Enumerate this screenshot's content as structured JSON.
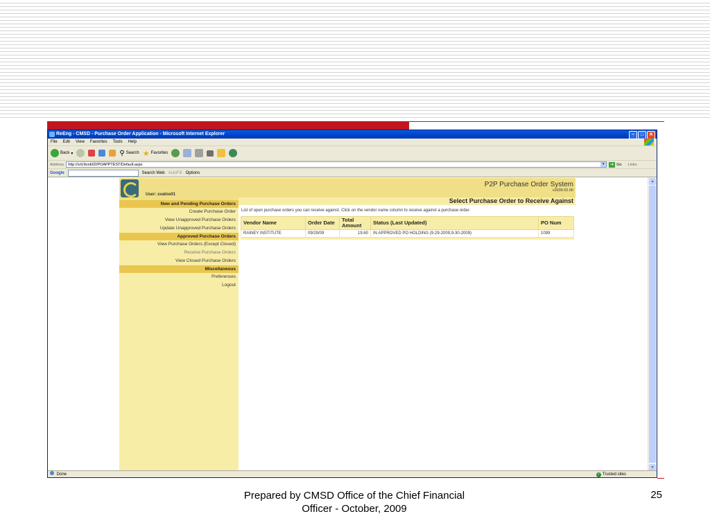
{
  "browser": {
    "title": "ReEng - CMSD - Purchase Order Application - Microsoft Internet Explorer",
    "menu": [
      "File",
      "Edit",
      "View",
      "Favorites",
      "Tools",
      "Help"
    ],
    "toolbar": {
      "back": "Back",
      "search": "Search",
      "favorites": "Favorites"
    },
    "address_label": "Address",
    "address": "http://srlc9onb02/POAPPTEST/Default.aspx",
    "go": "Go",
    "links": "Links",
    "google": {
      "brand": "Google",
      "search_web": "Search Web",
      "autofill": "AutoFill",
      "options": "Options"
    },
    "status": "Done",
    "zone": "Trusted sites"
  },
  "app": {
    "user": "User: svatno01",
    "system_title": "P2P Purchase Order System",
    "version": "v2009.02.00",
    "nav": [
      {
        "type": "header",
        "label": "New and Pending Purchase Orders"
      },
      {
        "type": "item",
        "label": "Create Purchase Order"
      },
      {
        "type": "item",
        "label": "View Unapproved Purchase Orders"
      },
      {
        "type": "item",
        "label": "Update Unapproved Purchase Orders"
      },
      {
        "type": "header",
        "label": "Approved Purchase Orders"
      },
      {
        "type": "item",
        "label": "View Purchase Orders (Except Closed)"
      },
      {
        "type": "item",
        "label": "Receive Purchase Orders"
      },
      {
        "type": "item",
        "label": "View Closed Purchase Orders"
      },
      {
        "type": "header",
        "label": "Miscellaneous"
      },
      {
        "type": "item",
        "label": "Preferences"
      },
      {
        "type": "item",
        "label": "Logout"
      }
    ],
    "page_heading": "Select Purchase Order to Receive Against",
    "description": "List of open purchase orders you can receive against. Click on the vendor name column to receive against a purchase order.",
    "table": {
      "headers": {
        "vendor": "Vendor Name",
        "date": "Order Date",
        "amount": "Total Amount",
        "status": "Status (Last Updated)",
        "po": "PO Num"
      },
      "rows": [
        {
          "vendor": "RAINEY INSTITUTE",
          "date": "09/29/09",
          "amount": "19.60",
          "status": "IN APPROVED PO HOLDING (9-29-2009,9-30-2009)",
          "po": "1099"
        }
      ]
    }
  },
  "slide": {
    "footer": "Prepared by CMSD Office of the Chief Financial Officer - October, 2009",
    "page_number": "25"
  },
  "colors": {
    "accent_red": "#c0161d",
    "nav_header": "#e9c64e",
    "panel": "#f7eda7",
    "xp_blue": "#0043c7"
  }
}
